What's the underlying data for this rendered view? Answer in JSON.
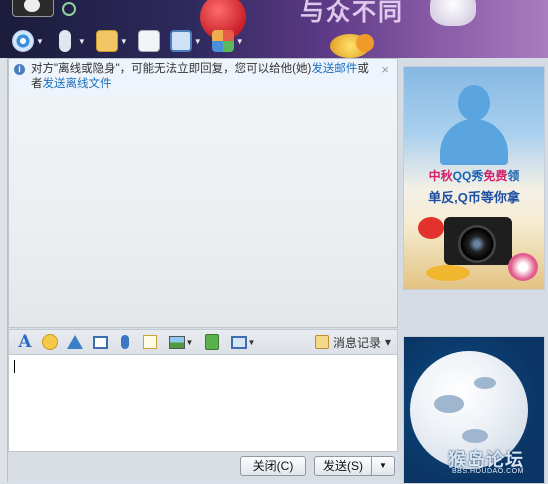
{
  "window": {
    "banner_text": "与众不同"
  },
  "toolbar": {
    "items": [
      {
        "name": "video-call",
        "icon": "video-camera-icon"
      },
      {
        "name": "voice-call",
        "icon": "microphone-icon"
      },
      {
        "name": "send-file",
        "icon": "folder-arrow-icon"
      },
      {
        "name": "create-discussion",
        "icon": "chat-plus-icon"
      },
      {
        "name": "remote-assist",
        "icon": "monitor-arrow-icon"
      },
      {
        "name": "apps",
        "icon": "apps-grid-icon"
      }
    ]
  },
  "notice": {
    "text_before": "对方\"离线或隐身\"，可能无法立即回复，您可以给他(她)",
    "link_mail": "发送邮件",
    "text_mid": "或者",
    "link_file": "发送离线文件",
    "close": "×"
  },
  "input_toolbar": {
    "font": "A",
    "history_label": "消息记录",
    "history_arrow": "▾"
  },
  "buttons": {
    "close_label": "关闭(C)",
    "send_label": "发送(S)",
    "send_arrow": "▼"
  },
  "ad": {
    "line1_a": "中秋",
    "line1_b": "QQ秀",
    "line1_c": "免费",
    "line1_d": "领",
    "line2": "单反,Q币等你拿"
  },
  "watermark": {
    "main": "猴岛论坛",
    "sub": "BBS.HOUDAO.COM"
  },
  "colors": {
    "link": "#1a6fc1",
    "banner_start": "#1b1c3b",
    "banner_end": "#a97bbf"
  }
}
